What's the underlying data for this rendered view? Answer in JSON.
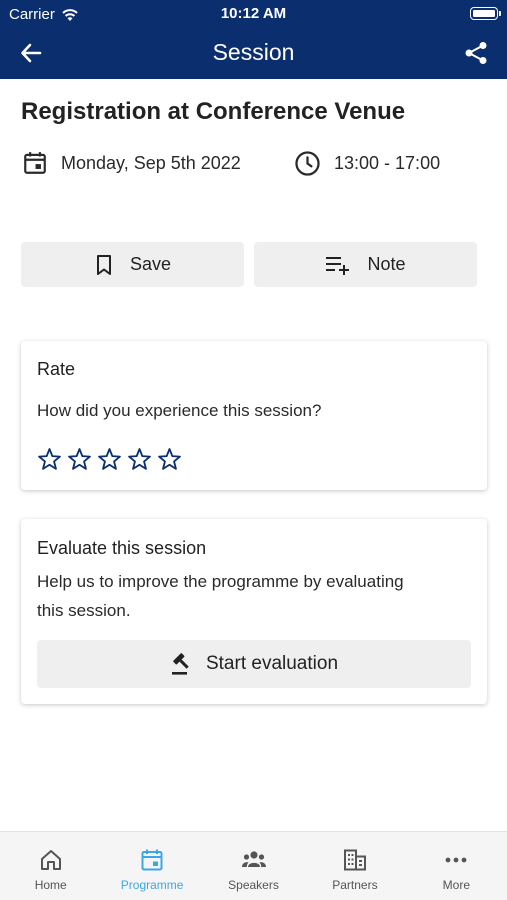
{
  "status_bar": {
    "carrier": "Carrier",
    "time": "10:12 AM"
  },
  "header": {
    "title": "Session",
    "back_icon": "arrow-left-icon",
    "share_icon": "share-icon"
  },
  "session": {
    "title": "Registration at Conference Venue",
    "date": "Monday, Sep 5th 2022",
    "time": "13:00 - 17:00"
  },
  "actions": {
    "save_label": "Save",
    "note_label": "Note"
  },
  "rate": {
    "title": "Rate",
    "question": "How did you experience this session?",
    "rating": 0,
    "max_rating": 5
  },
  "evaluate": {
    "title": "Evaluate this session",
    "text_line1": "Help us to improve the programme by evaluating",
    "text_line2": "this session.",
    "button_label": "Start evaluation"
  },
  "tabs": [
    {
      "label": "Home",
      "icon": "home-icon"
    },
    {
      "label": "Programme",
      "icon": "calendar-icon",
      "active": true
    },
    {
      "label": "Speakers",
      "icon": "people-icon"
    },
    {
      "label": "Partners",
      "icon": "building-icon"
    },
    {
      "label": "More",
      "icon": "more-icon"
    }
  ],
  "colors": {
    "header_bg": "#0b2e6f",
    "accent": "#3aa8e6",
    "star": "#0b2e6f",
    "button_bg": "#efefef"
  }
}
